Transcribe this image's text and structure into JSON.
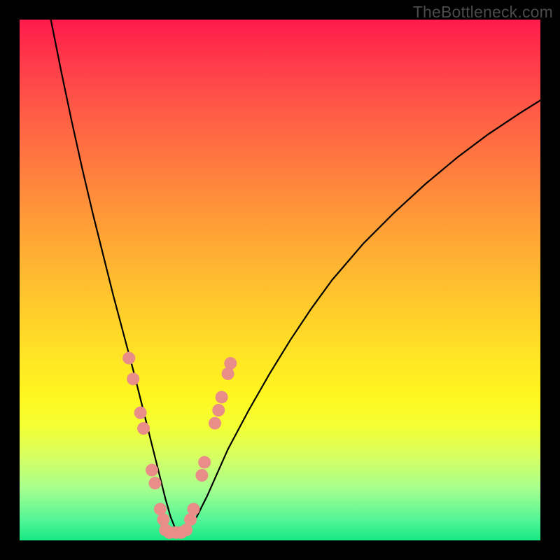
{
  "watermark": "TheBottleneck.com",
  "colors": {
    "frame": "#000000",
    "curve": "#000000",
    "marker_fill": "#e98d88",
    "marker_stroke": "#c96a65"
  },
  "chart_data": {
    "type": "line",
    "title": "",
    "xlabel": "",
    "ylabel": "",
    "xlim": [
      0,
      100
    ],
    "ylim": [
      0,
      100
    ],
    "series": [
      {
        "name": "bottleneck-curve",
        "x": [
          6,
          8,
          10,
          12,
          14,
          16,
          18,
          20,
          22,
          24,
          25,
          26,
          27,
          28,
          29,
          30,
          32,
          34,
          36,
          38,
          40,
          44,
          48,
          52,
          56,
          60,
          66,
          72,
          78,
          84,
          90,
          96,
          100
        ],
        "y": [
          100,
          90,
          80.5,
          71.5,
          63,
          55,
          47,
          39.5,
          32,
          24,
          20,
          16,
          12,
          8,
          4.5,
          2,
          2,
          4.5,
          8.5,
          13,
          17.5,
          25,
          32,
          38.5,
          44.5,
          50,
          57,
          63,
          68.5,
          73.5,
          78,
          82,
          84.5
        ]
      }
    ],
    "markers": [
      {
        "x": 21.0,
        "y": 35.0
      },
      {
        "x": 21.8,
        "y": 31.0
      },
      {
        "x": 23.2,
        "y": 24.5
      },
      {
        "x": 23.8,
        "y": 21.5
      },
      {
        "x": 25.4,
        "y": 13.5
      },
      {
        "x": 26.0,
        "y": 11.0
      },
      {
        "x": 27.0,
        "y": 6.0
      },
      {
        "x": 27.6,
        "y": 4.0
      },
      {
        "x": 28.0,
        "y": 2.0
      },
      {
        "x": 28.8,
        "y": 1.5
      },
      {
        "x": 30.0,
        "y": 1.5
      },
      {
        "x": 31.0,
        "y": 1.5
      },
      {
        "x": 32.0,
        "y": 2.0
      },
      {
        "x": 32.8,
        "y": 4.0
      },
      {
        "x": 33.4,
        "y": 6.0
      },
      {
        "x": 35.0,
        "y": 12.5
      },
      {
        "x": 35.5,
        "y": 15.0
      },
      {
        "x": 37.5,
        "y": 22.5
      },
      {
        "x": 38.2,
        "y": 25.0
      },
      {
        "x": 38.8,
        "y": 27.5
      },
      {
        "x": 40.0,
        "y": 32.0
      },
      {
        "x": 40.5,
        "y": 34.0
      }
    ]
  }
}
